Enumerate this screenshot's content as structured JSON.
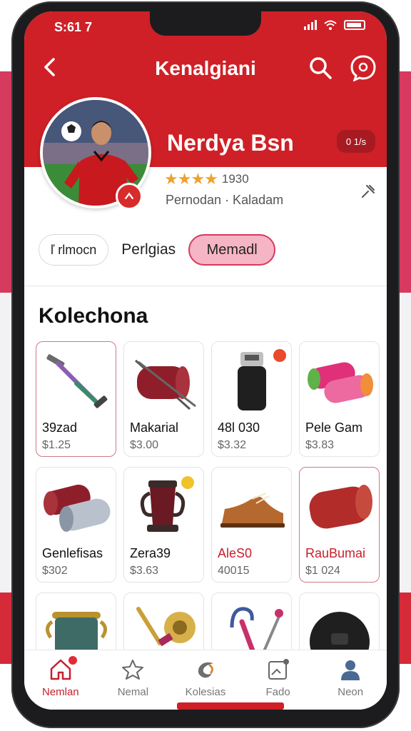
{
  "status": {
    "time": "S:61 7"
  },
  "header": {
    "title": "Kenalgiani",
    "colors": {
      "primary": "#cf2027",
      "accent": "#d63a5e"
    },
    "icons": [
      "back-icon",
      "search-icon",
      "chat-icon"
    ]
  },
  "profile": {
    "name": "Nerdya Bsn",
    "badge_count": "0 1/s",
    "stars": "★★★★",
    "rating": "1930",
    "subtitle": "Pernodan · Kaladam"
  },
  "tabs": [
    {
      "label": "ľ rlmocn"
    },
    {
      "label": "Perlgias"
    },
    {
      "label": "Memadl",
      "active": true
    }
  ],
  "section": {
    "title": "Kolechona"
  },
  "products": [
    {
      "name": "39zad",
      "price": "$1.25"
    },
    {
      "name": "Makarial",
      "price": "$3.00"
    },
    {
      "name": "48l 030",
      "price": "$3.32"
    },
    {
      "name": "Pele Gam",
      "price": "$3.83"
    },
    {
      "name": "Genlefisas",
      "price": "$302"
    },
    {
      "name": "Zera39",
      "price": "$3.63"
    },
    {
      "name": "AleS0",
      "price": "40015"
    },
    {
      "name": "RauBumai",
      "price": "$1 024"
    },
    {
      "name": "",
      "price": ""
    },
    {
      "name": "",
      "price": ""
    },
    {
      "name": "",
      "price": ""
    },
    {
      "name": "",
      "price": ""
    }
  ],
  "bottom_nav": [
    {
      "label": "Nemlan",
      "icon": "home-icon",
      "active": true
    },
    {
      "label": "Nemal",
      "icon": "star-icon"
    },
    {
      "label": "Kolesias",
      "icon": "swirl-icon"
    },
    {
      "label": "Fado",
      "icon": "photo-icon"
    },
    {
      "label": "Neon",
      "icon": "person-icon"
    }
  ]
}
